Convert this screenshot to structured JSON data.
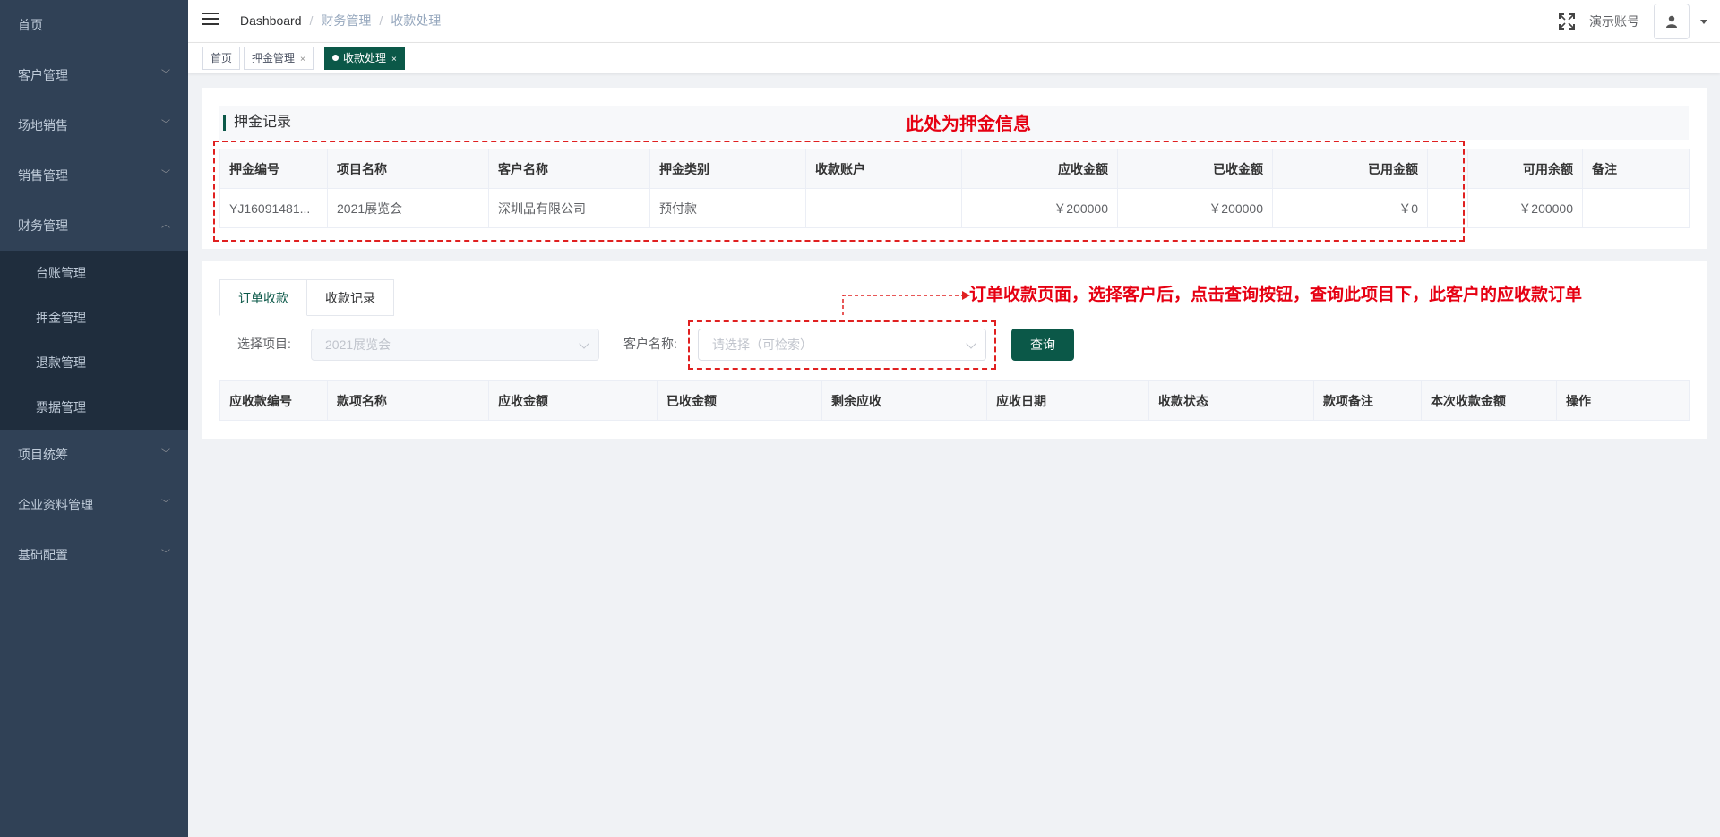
{
  "sidebar": {
    "items": [
      {
        "label": "首页"
      },
      {
        "label": "客户管理"
      },
      {
        "label": "场地销售"
      },
      {
        "label": "销售管理"
      },
      {
        "label": "财务管理"
      },
      {
        "label": "项目统筹"
      },
      {
        "label": "企业资料管理"
      },
      {
        "label": "基础配置"
      }
    ],
    "finance_sub": [
      {
        "label": "台账管理"
      },
      {
        "label": "押金管理"
      },
      {
        "label": "退款管理"
      },
      {
        "label": "票据管理"
      }
    ]
  },
  "header": {
    "breadcrumb": [
      "Dashboard",
      "财务管理",
      "收款处理"
    ],
    "user": "演示账号"
  },
  "tags": [
    {
      "label": "首页"
    },
    {
      "label": "押金管理",
      "close": "×"
    },
    {
      "label": "收款处理",
      "close": "×"
    }
  ],
  "deposit": {
    "title": "押金记录",
    "columns": [
      "押金编号",
      "项目名称",
      "客户名称",
      "押金类别",
      "收款账户",
      "应收金额",
      "已收金额",
      "已用金额",
      "",
      "可用余额",
      "备注"
    ],
    "rows": [
      [
        "YJ16091481...",
        "2021展览会",
        "深圳品有限公司",
        "预付款",
        "",
        "￥200000",
        "￥200000",
        "￥0",
        "",
        "￥200000",
        ""
      ]
    ]
  },
  "order": {
    "tabs": [
      "订单收款",
      "收款记录"
    ],
    "project_label": "选择项目:",
    "project_value": "2021展览会",
    "customer_label": "客户名称:",
    "customer_placeholder": "请选择（可检索）",
    "query_button": "查询",
    "columns": [
      "应收款编号",
      "款项名称",
      "应收金额",
      "已收金额",
      "剩余应收",
      "应收日期",
      "收款状态",
      "款项备注",
      "本次收款金额",
      "操作"
    ]
  },
  "annotations": {
    "deposit_note": "此处为押金信息",
    "order_note": "订单收款页面，选择客户后，点击查询按钮，查询此项目下，此客户的应收款订单"
  },
  "colors": {
    "sidebar_bg": "#304156",
    "accent": "#0b5848",
    "annotation": "#e60012"
  }
}
